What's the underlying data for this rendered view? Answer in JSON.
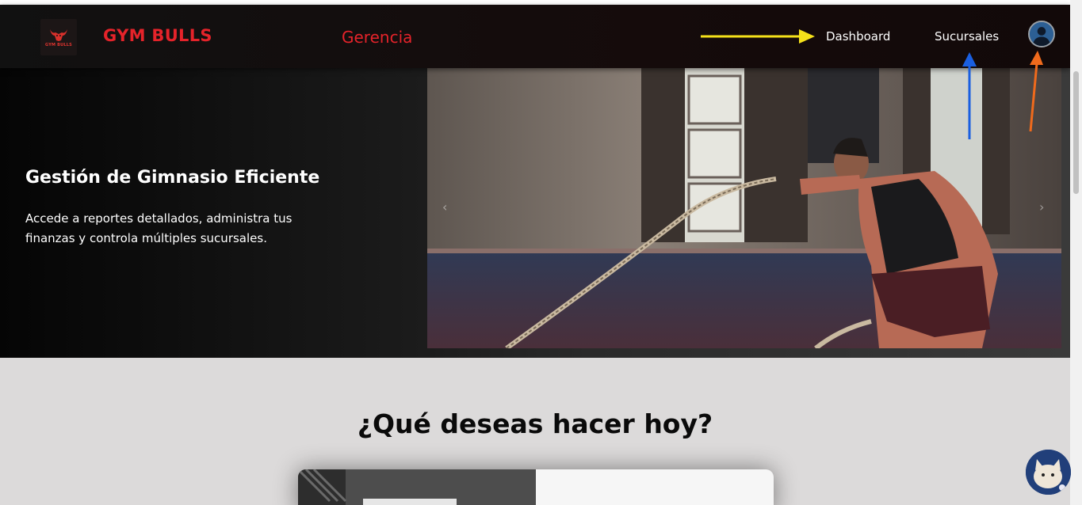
{
  "header": {
    "logo_text": "GYM BULLS",
    "brand": "GYM BULLS",
    "section": "Gerencia",
    "nav": {
      "dashboard": "Dashboard",
      "branches": "Sucursales"
    }
  },
  "hero": {
    "title": "Gestión de Gimnasio Eficiente",
    "text": "Accede a reportes detallados, administra tus finanzas y controla múltiples sucursales.",
    "prev_icon": "‹",
    "next_icon": "›"
  },
  "main": {
    "heading": "¿Qué deseas hacer hoy?"
  },
  "colors": {
    "brand_red": "#e5232a",
    "arrow_yellow": "#f5e11a",
    "arrow_blue": "#1a5fe0",
    "arrow_orange": "#f06a1c"
  },
  "icons": [
    "bull-logo-icon",
    "user-avatar-icon",
    "chevron-left-icon",
    "chevron-right-icon",
    "chat-avatar-icon"
  ]
}
